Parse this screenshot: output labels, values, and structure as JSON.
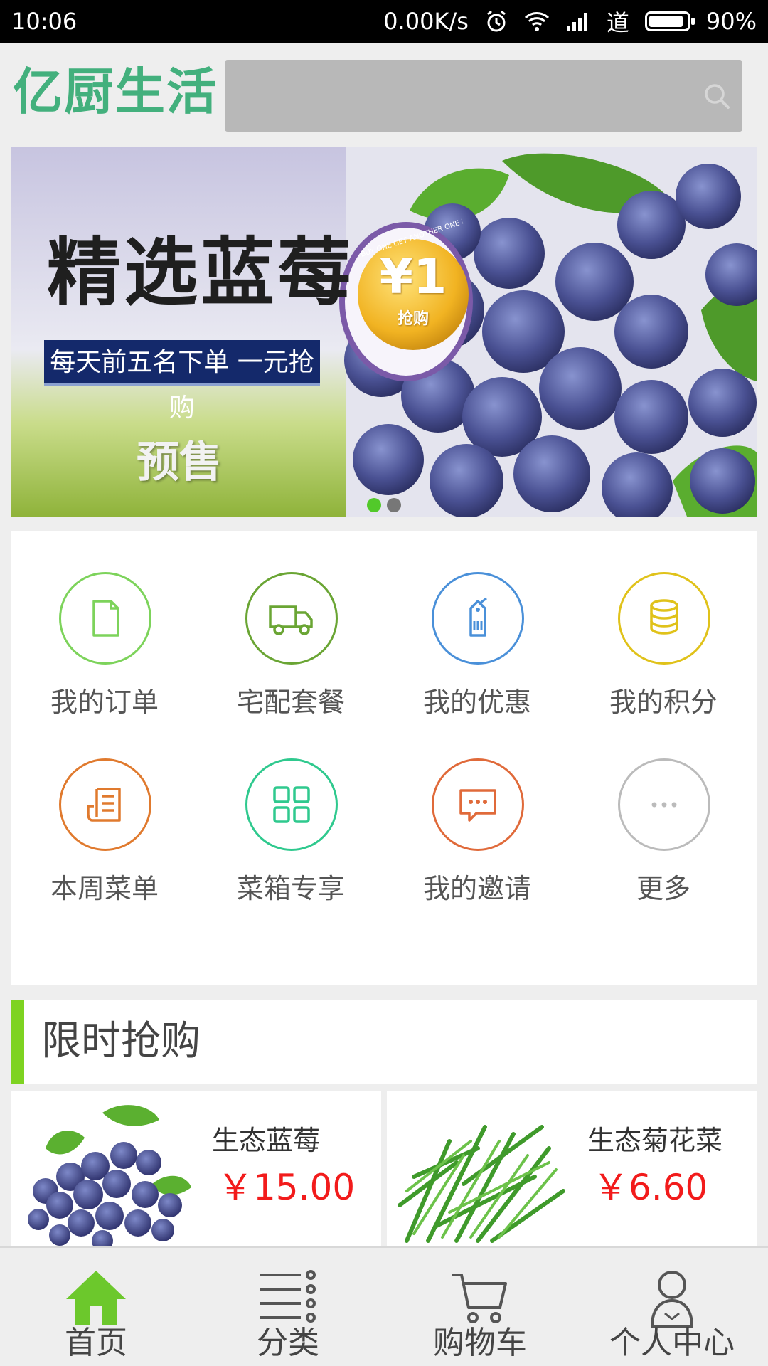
{
  "status_bar": {
    "time": "10:06",
    "net_speed": "0.00K/s",
    "carrier": "道",
    "battery": "90%",
    "battery_level": 0.9,
    "icons": [
      "alarm-icon",
      "wifi-icon",
      "signal-icon",
      "battery-icon"
    ]
  },
  "header": {
    "logo": "亿厨生活",
    "search_placeholder": "",
    "search_icon": "search-icon"
  },
  "banner": {
    "title": "精选蓝莓",
    "subtitle": "每天前五名下单 一元抢购",
    "tag": "预售",
    "badge": "¥1",
    "badge_sub": "抢购",
    "badge_ring_text": "BUY ONE GET ANOTHER ONE FOR",
    "dots": 2,
    "active_dot": 0
  },
  "features": {
    "items": [
      {
        "label": "我的订单",
        "icon": "document-icon",
        "color": "#7dd35b"
      },
      {
        "label": "宅配套餐",
        "icon": "truck-icon",
        "color": "#6aa534"
      },
      {
        "label": "我的优惠",
        "icon": "price-tag-icon",
        "color": "#4a90d9"
      },
      {
        "label": "我的积分",
        "icon": "coins-icon",
        "color": "#e0c21a"
      },
      {
        "label": "本周菜单",
        "icon": "menu-list-icon",
        "color": "#e07a2e"
      },
      {
        "label": "菜箱专享",
        "icon": "grid-icon",
        "color": "#2fc98e"
      },
      {
        "label": "我的邀请",
        "icon": "chat-icon",
        "color": "#e06a3a"
      },
      {
        "label": "更多",
        "icon": "more-icon",
        "color": "#bbbbbb"
      }
    ]
  },
  "flash_sale": {
    "title": "限时抢购",
    "accent": "#7ed321",
    "products": [
      {
        "name": "生态蓝莓",
        "price": "￥15.00",
        "image": "blueberry-image"
      },
      {
        "name": "生态菊花菜",
        "price": "￥6.60",
        "image": "chrysanthemum-greens-image"
      }
    ]
  },
  "bottom_nav": {
    "active": 0,
    "active_color": "#6cc82c",
    "items": [
      {
        "label": "首页",
        "icon": "home-icon"
      },
      {
        "label": "分类",
        "icon": "category-list-icon"
      },
      {
        "label": "购物车",
        "icon": "cart-icon"
      },
      {
        "label": "个人中心",
        "icon": "user-icon"
      }
    ]
  }
}
